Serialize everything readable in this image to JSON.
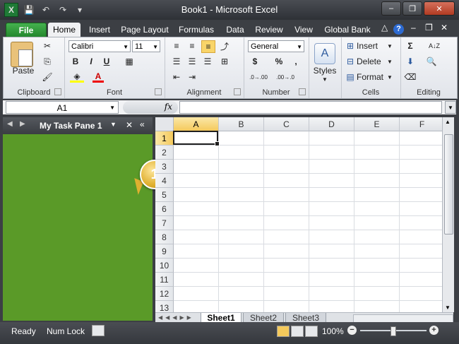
{
  "window": {
    "title": "Book1  -  Microsoft Excel",
    "app_icon": "X",
    "controls": {
      "minimize": "–",
      "restore": "❐",
      "close": "✕"
    }
  },
  "quick_access": {
    "save": "💾",
    "undo": "↶",
    "redo": "↷",
    "customize": "▾"
  },
  "ribbon_tabs": [
    {
      "label": "File"
    },
    {
      "label": "Home"
    },
    {
      "label": "Insert"
    },
    {
      "label": "Page Layout"
    },
    {
      "label": "Formulas"
    },
    {
      "label": "Data"
    },
    {
      "label": "Review"
    },
    {
      "label": "View"
    },
    {
      "label": "Global Bank"
    }
  ],
  "ribbon_controls": {
    "collapse": "△",
    "help": "?",
    "min": "–",
    "restore": "❐",
    "close": "✕"
  },
  "ribbon": {
    "clipboard": {
      "label": "Clipboard",
      "paste": "Paste"
    },
    "font": {
      "label": "Font",
      "family": "Calibri",
      "size": "11",
      "bold": "B",
      "italic": "I",
      "underline": "U",
      "font_color": "A"
    },
    "alignment": {
      "label": "Alignment"
    },
    "number": {
      "label": "Number",
      "format": "General",
      "currency": "$",
      "percent": "%",
      "comma": ",",
      "inc_decimal": ".0→.00",
      "dec_decimal": ".00→.0"
    },
    "styles": {
      "label": "Styles"
    },
    "cells": {
      "label": "Cells",
      "insert": "Insert",
      "delete": "Delete",
      "format": "Format"
    },
    "editing": {
      "label": "Editing",
      "sum": "Σ",
      "sort": "A↓Z"
    }
  },
  "formula_bar": {
    "name_box": "A1",
    "fx": "fx",
    "value": ""
  },
  "task_pane": {
    "title": "My Task Pane 1",
    "callout_number": "1"
  },
  "columns": [
    "A",
    "B",
    "C",
    "D",
    "E",
    "F"
  ],
  "rows": [
    "1",
    "2",
    "3",
    "4",
    "5",
    "6",
    "7",
    "8",
    "9",
    "10",
    "11",
    "12",
    "13"
  ],
  "sheets": [
    "Sheet1",
    "Sheet2",
    "Sheet3"
  ],
  "status_bar": {
    "ready": "Ready",
    "num_lock": "Num Lock",
    "zoom": "100%"
  }
}
